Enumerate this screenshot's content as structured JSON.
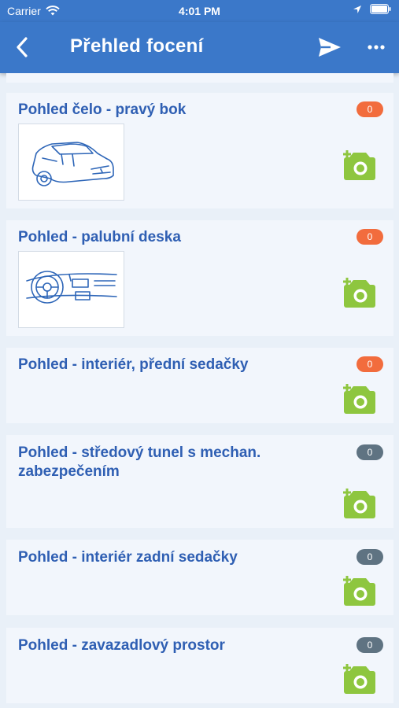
{
  "status": {
    "carrier": "Carrier",
    "time": "4:01 PM"
  },
  "nav": {
    "title": "Přehled focení"
  },
  "items": [
    {
      "title": "Pohled čelo - pravý bok",
      "count": "0"
    },
    {
      "title": "Pohled - palubní deska",
      "count": "0"
    },
    {
      "title": "Pohled - interiér, přední sedačky",
      "count": "0"
    },
    {
      "title": "Pohled - středový tunel s mechan. zabezpečením",
      "count": "0"
    },
    {
      "title": "Pohled - interiér zadní sedačky",
      "count": "0"
    },
    {
      "title": "Pohled - zavazadlový prostor",
      "count": "0"
    }
  ],
  "colors": {
    "header": "#3b78c9",
    "title_text": "#2f5fb3",
    "badge_active": "#f26c3d",
    "badge_inactive": "#5f7382",
    "camera_green": "#8ec63f"
  }
}
